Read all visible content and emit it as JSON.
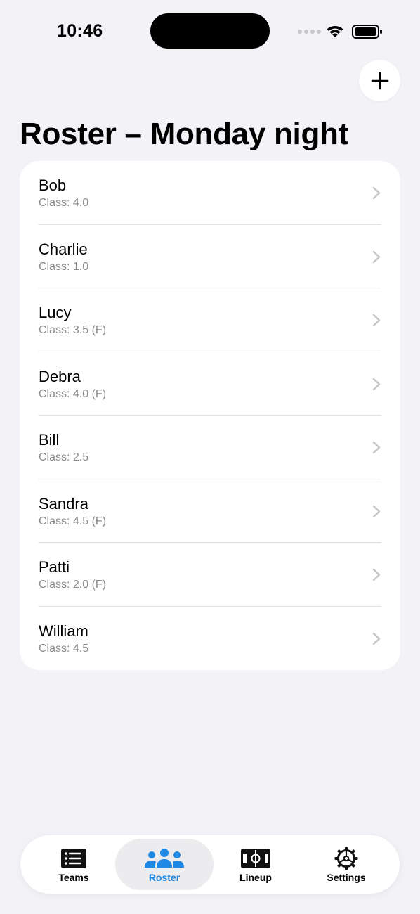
{
  "status_bar": {
    "time": "10:46"
  },
  "header": {
    "title": "Roster – Monday night",
    "add_icon": "plus-icon"
  },
  "roster": [
    {
      "name": "Bob",
      "detail": "Class: 4.0"
    },
    {
      "name": "Charlie",
      "detail": "Class: 1.0"
    },
    {
      "name": "Lucy",
      "detail": "Class: 3.5 (F)"
    },
    {
      "name": "Debra",
      "detail": "Class: 4.0 (F)"
    },
    {
      "name": "Bill",
      "detail": "Class: 2.5"
    },
    {
      "name": "Sandra",
      "detail": "Class: 4.5 (F)"
    },
    {
      "name": "Patti",
      "detail": "Class: 2.0 (F)"
    },
    {
      "name": "William",
      "detail": "Class: 4.5"
    }
  ],
  "tabs": [
    {
      "label": "Teams",
      "icon": "list-icon",
      "active": false
    },
    {
      "label": "Roster",
      "icon": "people-icon",
      "active": true
    },
    {
      "label": "Lineup",
      "icon": "court-icon",
      "active": false
    },
    {
      "label": "Settings",
      "icon": "gear-icon",
      "active": false
    }
  ],
  "colors": {
    "accent": "#1e88e5",
    "background": "#f2f2f7",
    "secondary_text": "#8a8a8e"
  }
}
